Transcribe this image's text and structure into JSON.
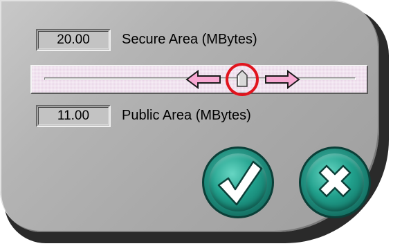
{
  "secure_area": {
    "value": "20.00",
    "label": "Secure Area (MBytes)"
  },
  "public_area": {
    "value": "11.00",
    "label": "Public Area (MBytes)"
  },
  "slider": {
    "position_fraction": 0.64
  },
  "buttons": {
    "ok_icon": "checkmark-icon",
    "cancel_icon": "close-x-icon"
  },
  "colors": {
    "button_teal": "#1d8a7a",
    "arrow_pink": "#f7a8d2",
    "highlight_red": "#e1141e",
    "panel_gray": "#b4b4b4"
  }
}
